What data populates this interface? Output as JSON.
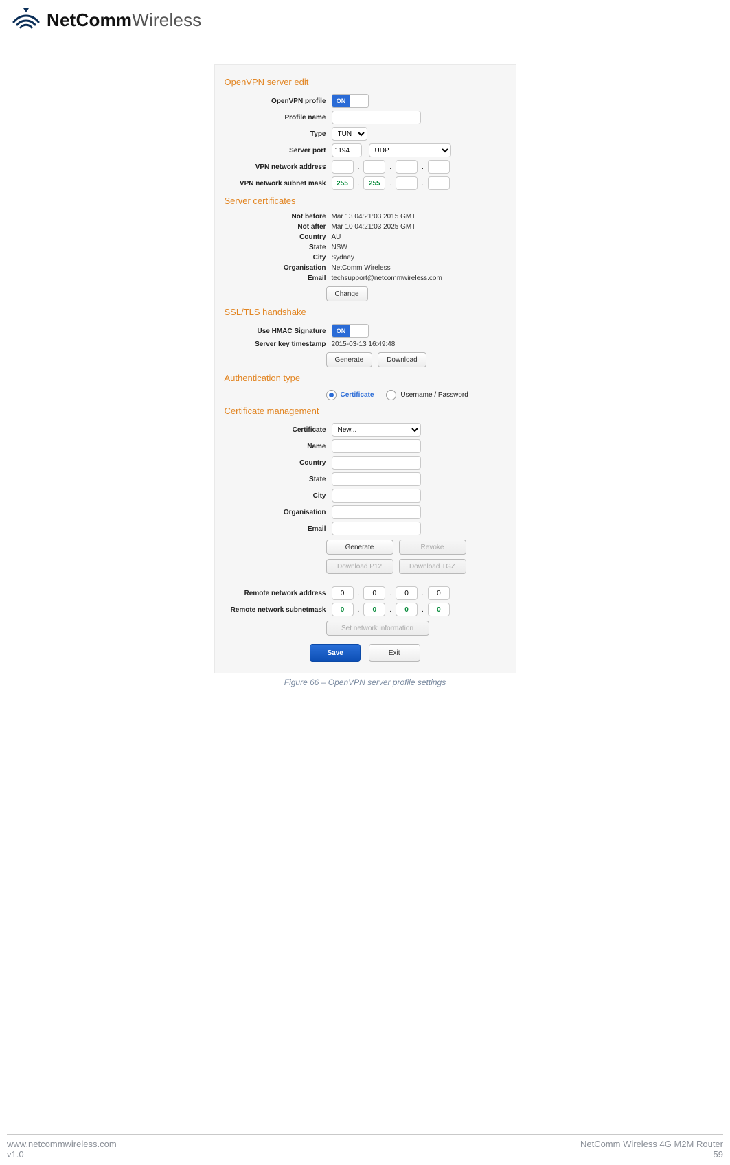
{
  "brand": {
    "strong": "NetComm",
    "light": "Wireless"
  },
  "sections": {
    "s1": "OpenVPN server edit",
    "s2": "Server certificates",
    "s3": "SSL/TLS handshake",
    "s4": "Authentication type",
    "s5": "Certificate management"
  },
  "labels": {
    "profile": "OpenVPN profile",
    "pname": "Profile name",
    "type": "Type",
    "sport": "Server port",
    "vna": "VPN network address",
    "vnsm": "VPN network subnet mask",
    "nb": "Not before",
    "na": "Not after",
    "country": "Country",
    "state": "State",
    "city": "City",
    "org": "Organisation",
    "email": "Email",
    "hmac": "Use HMAC Signature",
    "skts": "Server key timestamp",
    "cert": "Certificate",
    "name": "Name",
    "rna": "Remote network address",
    "rns": "Remote network subnetmask"
  },
  "values": {
    "on": "ON",
    "type": "TUN",
    "port": "1194",
    "proto": "UDP",
    "mask": [
      "255",
      "255",
      "",
      ""
    ],
    "nb": "Mar 13 04:21:03 2015 GMT",
    "na": "Mar 10 04:21:03 2025 GMT",
    "country": "AU",
    "state": "NSW",
    "city": "Sydney",
    "org": "NetComm Wireless",
    "email": "techsupport@netcommwireless.com",
    "skts": "2015-03-13 16:49:48",
    "cert": "New...",
    "rna": [
      "0",
      "0",
      "0",
      "0"
    ],
    "rns": [
      "0",
      "0",
      "0",
      "0"
    ]
  },
  "buttons": {
    "change": "Change",
    "generate": "Generate",
    "download": "Download",
    "revoke": "Revoke",
    "dlp12": "Download P12",
    "dltgz": "Download TGZ",
    "setnet": "Set network information",
    "save": "Save",
    "exit": "Exit"
  },
  "auth": {
    "opt1": "Certificate",
    "opt2": "Username / Password"
  },
  "caption": "Figure 66 – OpenVPN server profile settings",
  "footer": {
    "url": "www.netcommwireless.com",
    "ver": "v1.0",
    "prod": "NetComm Wireless 4G M2M Router",
    "page": "59"
  }
}
